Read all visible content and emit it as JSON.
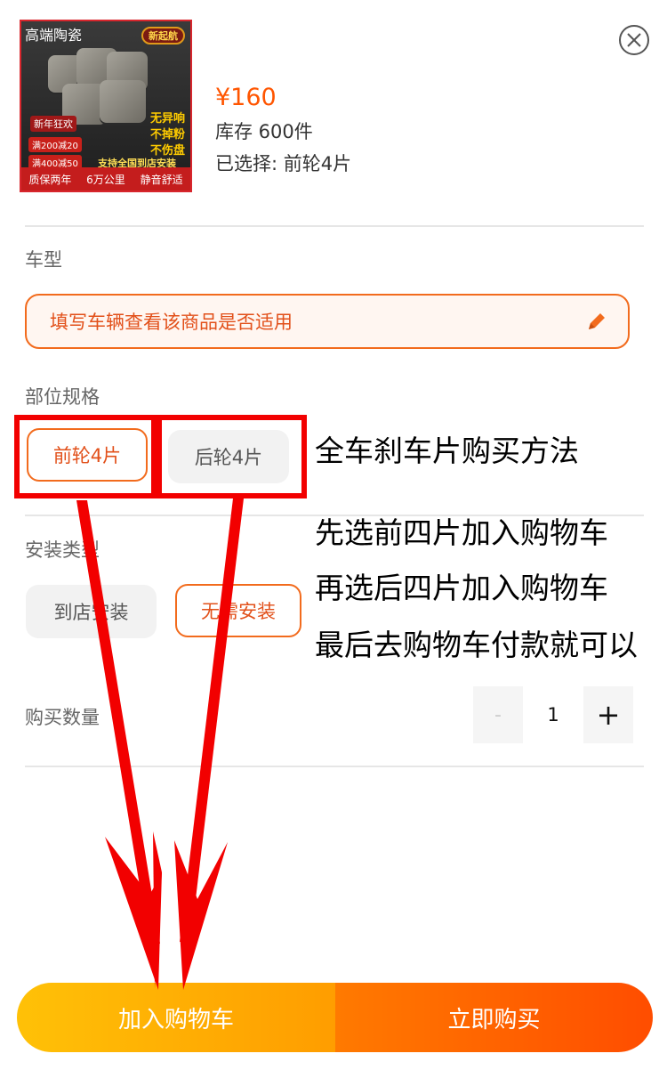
{
  "product": {
    "thumbnail": {
      "top_tag": "高端陶瓷",
      "brand": "新起航",
      "features": [
        "无异响",
        "不掉粉",
        "不伤盘"
      ],
      "badge": "新年狂欢",
      "deals": [
        "满200减20",
        "满400减50"
      ],
      "support": "支持全国到店安装",
      "bottom": [
        "质保两年",
        "6万公里",
        "静音舒适"
      ]
    },
    "price": "¥160",
    "stock": "库存 600件",
    "selected": "已选择: 前轮4片"
  },
  "close_icon": "close-icon",
  "vehicle": {
    "label": "车型",
    "placeholder": "填写车辆查看该商品是否适用",
    "edit_icon": "pencil-icon"
  },
  "spec": {
    "label": "部位规格",
    "options": [
      "前轮4片",
      "后轮4片"
    ],
    "selected_index": 0
  },
  "install": {
    "label": "安装类型",
    "options": [
      "到店安装",
      "无需安装"
    ],
    "selected_index": 1
  },
  "quantity": {
    "label": "购买数量",
    "minus": "-",
    "value": "1",
    "plus": "+"
  },
  "actions": {
    "add_to_cart": "加入购物车",
    "buy_now": "立即购买"
  },
  "annotation": {
    "title": "全车刹车片购买方法",
    "lines": [
      "先选前四片加入购物车",
      "再选后四片加入购物车",
      "最后去购物车付款就可以"
    ]
  },
  "colors": {
    "accent": "#ff5500",
    "cart_gradient": [
      "#ffc107",
      "#ff9d00"
    ],
    "buy_gradient": [
      "#ff7a00",
      "#ff4d00"
    ],
    "annotation_red": "#f20000"
  }
}
